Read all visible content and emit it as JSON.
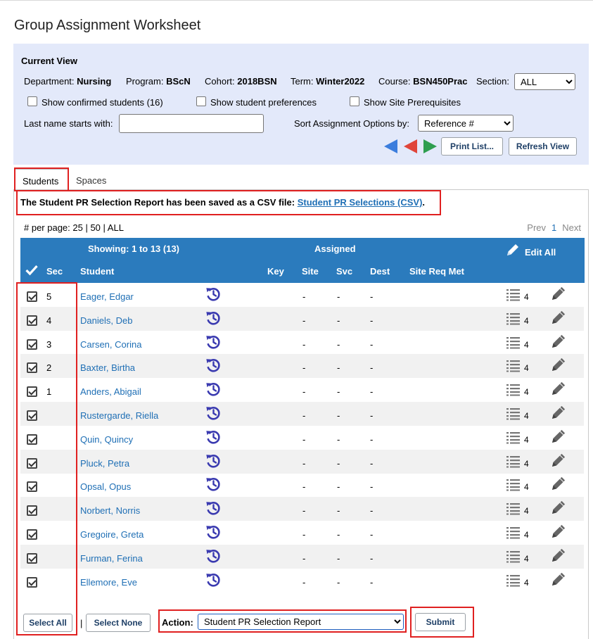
{
  "page": {
    "title": "Group Assignment Worksheet"
  },
  "current_view": {
    "heading": "Current View",
    "department_label": "Department:",
    "department_value": "Nursing",
    "program_label": "Program:",
    "program_value": "BScN",
    "cohort_label": "Cohort:",
    "cohort_value": "2018BSN",
    "term_label": "Term:",
    "term_value": "Winter2022",
    "course_label": "Course:",
    "course_value": "BSN450Prac",
    "section_label": "Section:",
    "section_value": "ALL",
    "show_confirmed_label": "Show confirmed students (16)",
    "show_preferences_label": "Show student preferences",
    "show_prereq_label": "Show Site Prerequisites",
    "last_name_label": "Last name starts with:",
    "last_name_value": "",
    "sort_label": "Sort Assignment Options by:",
    "sort_value": "Reference #",
    "print_button": "Print List...",
    "refresh_button": "Refresh View",
    "arrow_colors": {
      "blue": "#3b7ddd",
      "red": "#e0453a",
      "green": "#2e9e4f"
    }
  },
  "tabs": [
    {
      "label": "Students",
      "active": true
    },
    {
      "label": "Spaces",
      "active": false
    }
  ],
  "message": {
    "text": "The Student PR Selection Report has been saved as a CSV file: ",
    "link": "Student PR Selections (CSV)",
    "suffix": "."
  },
  "paging": {
    "per_page": "# per page: 25 | 50 | ALL",
    "prev": "Prev",
    "current": "1",
    "next": "Next"
  },
  "table": {
    "showing": "Showing: 1 to 13 (13)",
    "assigned": "Assigned",
    "edit_all": "Edit All",
    "columns": {
      "sec": "Sec",
      "student": "Student",
      "key": "Key",
      "site": "Site",
      "svc": "Svc",
      "dest": "Dest",
      "site_req_met": "Site Req Met"
    },
    "rows": [
      {
        "sec": "5",
        "student": "Eager, Edgar",
        "site": "-",
        "svc": "-",
        "dest": "-",
        "count": "4"
      },
      {
        "sec": "4",
        "student": "Daniels, Deb",
        "site": "-",
        "svc": "-",
        "dest": "-",
        "count": "4"
      },
      {
        "sec": "3",
        "student": "Carsen, Corina",
        "site": "-",
        "svc": "-",
        "dest": "-",
        "count": "4"
      },
      {
        "sec": "2",
        "student": "Baxter, Birtha",
        "site": "-",
        "svc": "-",
        "dest": "-",
        "count": "4"
      },
      {
        "sec": "1",
        "student": "Anders, Abigail",
        "site": "-",
        "svc": "-",
        "dest": "-",
        "count": "4"
      },
      {
        "sec": "",
        "student": "Rustergarde, Riella",
        "site": "-",
        "svc": "-",
        "dest": "-",
        "count": "4"
      },
      {
        "sec": "",
        "student": "Quin, Quincy",
        "site": "-",
        "svc": "-",
        "dest": "-",
        "count": "4"
      },
      {
        "sec": "",
        "student": "Pluck, Petra",
        "site": "-",
        "svc": "-",
        "dest": "-",
        "count": "4"
      },
      {
        "sec": "",
        "student": "Opsal, Opus",
        "site": "-",
        "svc": "-",
        "dest": "-",
        "count": "4"
      },
      {
        "sec": "",
        "student": "Norbert, Norris",
        "site": "-",
        "svc": "-",
        "dest": "-",
        "count": "4"
      },
      {
        "sec": "",
        "student": "Gregoire, Greta",
        "site": "-",
        "svc": "-",
        "dest": "-",
        "count": "4"
      },
      {
        "sec": "",
        "student": "Furman, Ferina",
        "site": "-",
        "svc": "-",
        "dest": "-",
        "count": "4"
      },
      {
        "sec": "",
        "student": "Ellemore, Eve",
        "site": "-",
        "svc": "-",
        "dest": "-",
        "count": "4"
      }
    ]
  },
  "footer": {
    "select_all": "Select All",
    "separator": "|",
    "select_none": "Select None",
    "action_label": "Action:",
    "action_value": "Student PR Selection Report",
    "submit": "Submit"
  }
}
